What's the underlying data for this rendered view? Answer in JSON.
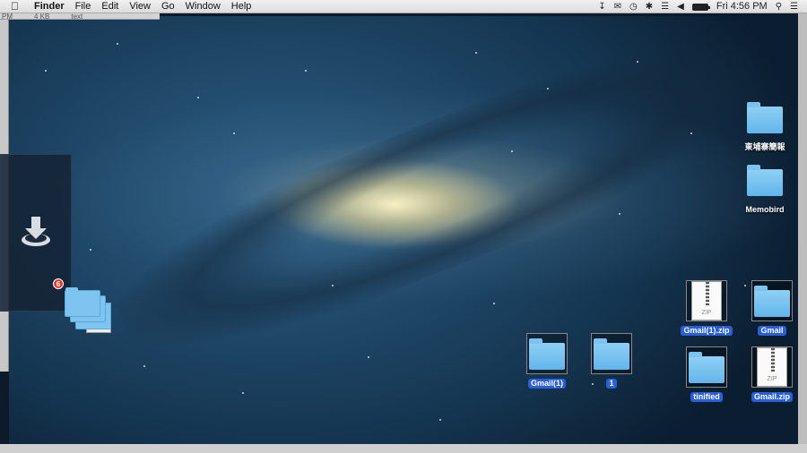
{
  "menubar": {
    "app_name": "Finder",
    "items": [
      "File",
      "Edit",
      "View",
      "Go",
      "Window",
      "Help"
    ],
    "clock": "Fri 4:56 PM"
  },
  "ghost_strip": {
    "col1": "PM",
    "col2": "4 KB",
    "col3": "text"
  },
  "stack": {
    "badge_count": "6",
    "zip_label": "ZIP"
  },
  "desktop": {
    "items": [
      {
        "label": "東埔寨簡報",
        "type": "folder",
        "selected": false
      },
      {
        "label": "Memobird",
        "type": "folder",
        "selected": false
      },
      {
        "label": "Gmail(1).zip",
        "type": "zip",
        "selected": true
      },
      {
        "label": "Gmail",
        "type": "folder",
        "selected": true
      },
      {
        "label": "tinified",
        "type": "folder",
        "selected": true
      },
      {
        "label": "Gmail.zip",
        "type": "zip",
        "selected": true
      },
      {
        "label": "Gmail(1)",
        "type": "folder",
        "selected": true
      },
      {
        "label": "1",
        "type": "folder",
        "selected": true
      }
    ],
    "zip_label": "ZIP"
  },
  "colors": {
    "selection": "#2a5fd8",
    "folder": "#7fc4f0",
    "badge": "#e53935"
  }
}
